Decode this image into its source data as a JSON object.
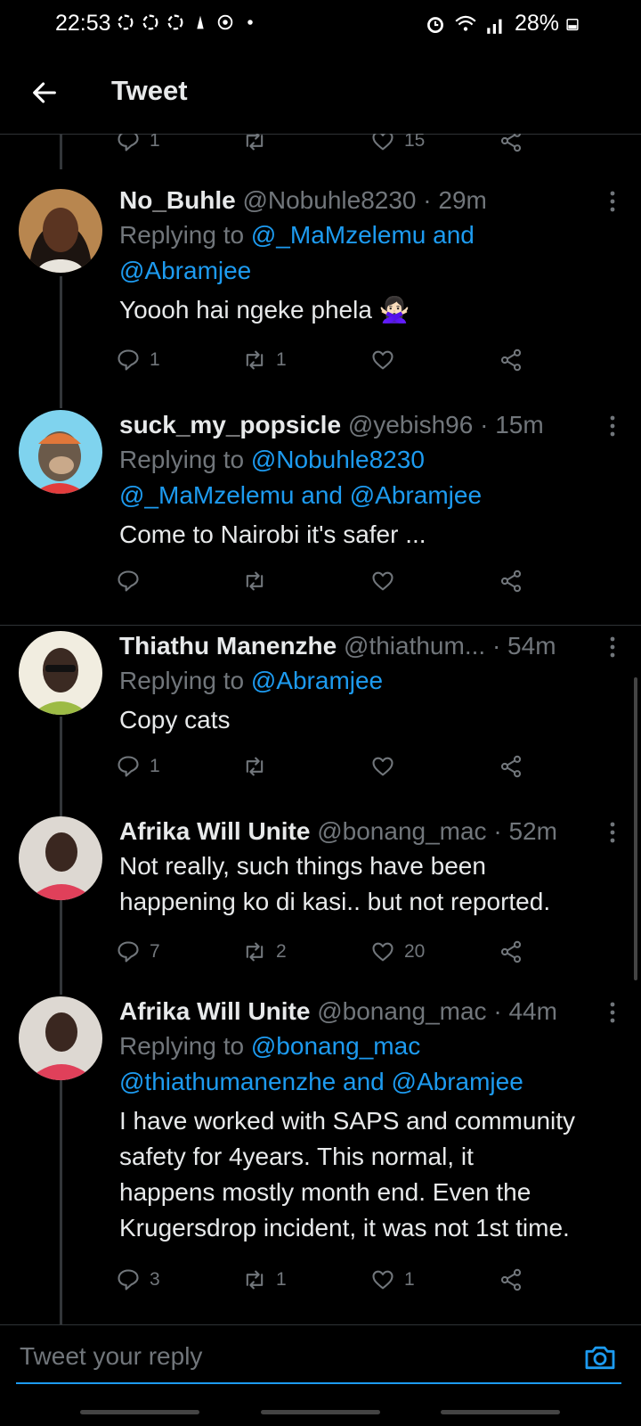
{
  "status_bar": {
    "time": "22:53",
    "battery": "28%"
  },
  "header": {
    "title": "Tweet"
  },
  "top_actions": {
    "replies": "1",
    "retweets": "",
    "likes": "15"
  },
  "tweets": [
    {
      "name": "No_Buhle",
      "handle": "@Nobuhle8230",
      "time": "· 29m",
      "reply_prefix": "Replying to ",
      "reply_line1": "@_MaMzelemu and",
      "reply_line2": "@Abramjee",
      "text_lines": [
        "Yoooh hai ngeke phela 🙅🏻‍♀️"
      ],
      "replies": "1",
      "retweets": "1",
      "likes": ""
    },
    {
      "name": "suck_my_popsicle",
      "handle": "@yebish96",
      "time": "· 15m",
      "reply_prefix": "Replying to ",
      "reply_line1": "@Nobuhle8230",
      "reply_line2": "@_MaMzelemu and @Abramjee",
      "text_lines": [
        "Come to Nairobi it's safer ..."
      ],
      "replies": "",
      "retweets": "",
      "likes": ""
    },
    {
      "name": "Thiathu Manenzhe",
      "handle": "@thiathum...",
      "time": "· 54m",
      "reply_prefix": "Replying to ",
      "reply_line1": "@Abramjee",
      "reply_line2": "",
      "text_lines": [
        "Copy cats"
      ],
      "replies": "1",
      "retweets": "",
      "likes": ""
    },
    {
      "name": "Afrika Will Unite",
      "handle": "@bonang_mac",
      "time": "· 52m",
      "reply_prefix": "",
      "reply_line1": "",
      "reply_line2": "",
      "text_lines": [
        "Not really, such things have been",
        "happening ko di kasi.. but not reported."
      ],
      "replies": "7",
      "retweets": "2",
      "likes": "20"
    },
    {
      "name": "Afrika Will Unite",
      "handle": "@bonang_mac",
      "time": "· 44m",
      "reply_prefix": "Replying to ",
      "reply_line1": "@bonang_mac",
      "reply_line2": "@thiathumanenzhe and @Abramjee",
      "text_lines": [
        "I have worked with SAPS and community",
        "safety for 4years. This normal, it",
        "happens mostly month end. Even the",
        "Krugersdrop incident, it was not 1st time."
      ],
      "replies": "3",
      "retweets": "1",
      "likes": "1"
    }
  ],
  "reply_bar": {
    "placeholder": "Tweet your reply"
  },
  "colors": {
    "accent": "#1d9bf0",
    "background": "#000000",
    "muted": "#71767b"
  }
}
